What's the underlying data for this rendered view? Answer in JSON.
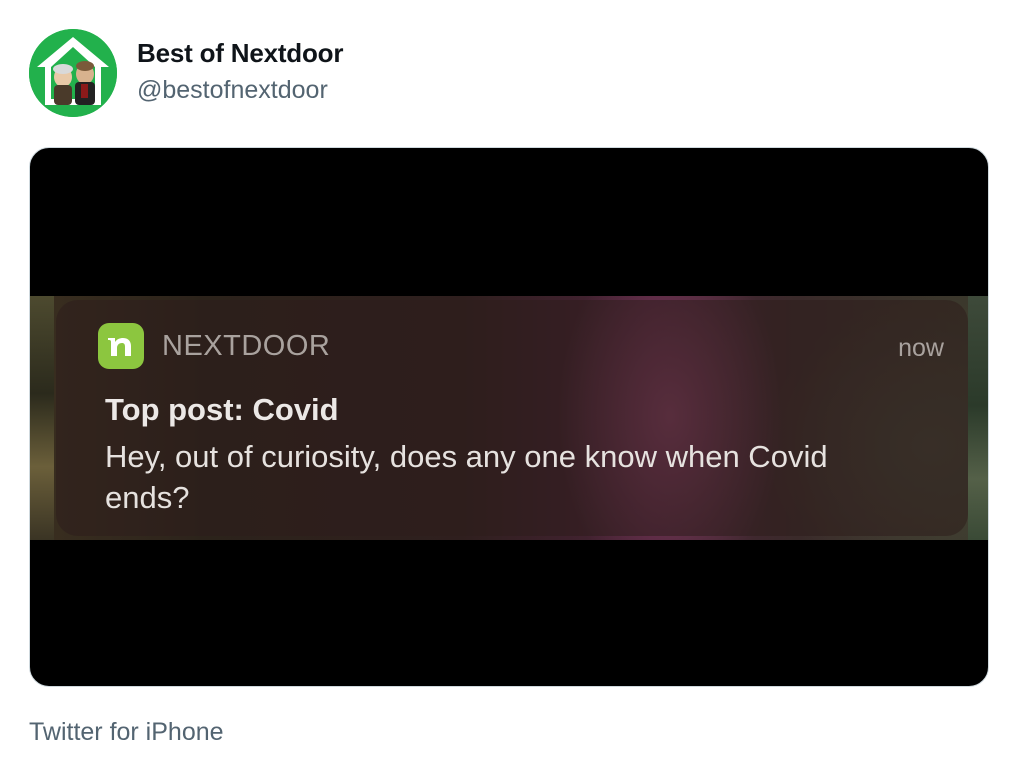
{
  "author": {
    "display_name": "Best of Nextdoor",
    "handle": "@bestofnextdoor",
    "avatar_icon": "house-muppets-avatar-icon",
    "avatar_color": "#22b14c"
  },
  "media": {
    "notification": {
      "app_icon": "nextdoor-app-icon",
      "app_icon_color": "#8cc63f",
      "app_name": "NEXTDOOR",
      "time": "now",
      "title": "Top post: Covid",
      "body": "Hey, out of curiosity, does any one know when Covid ends?"
    }
  },
  "footer": {
    "source": "Twitter for iPhone"
  },
  "colors": {
    "text_primary": "#0f1419",
    "text_secondary": "#536471",
    "media_border": "#cfd9de"
  }
}
